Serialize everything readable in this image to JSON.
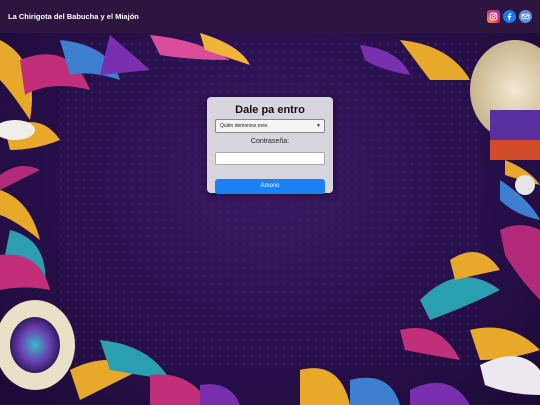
{
  "header": {
    "title": "La Chirigota del Babucha y el Miajón",
    "socials": [
      {
        "name": "instagram",
        "icon": "instagram-icon"
      },
      {
        "name": "facebook",
        "icon": "facebook-icon"
      },
      {
        "name": "email",
        "icon": "mail-icon"
      }
    ]
  },
  "login": {
    "title": "Dale pa entro",
    "user_select": {
      "selected": "Quién demonios eres"
    },
    "password_label": "Contraseña:",
    "password_value": "",
    "submit_label": "Amono"
  },
  "colors": {
    "header_bg": "#2d1540",
    "page_bg": "#2a1150",
    "panel_bg": "#d9d5df",
    "button": "#1a82f5"
  }
}
